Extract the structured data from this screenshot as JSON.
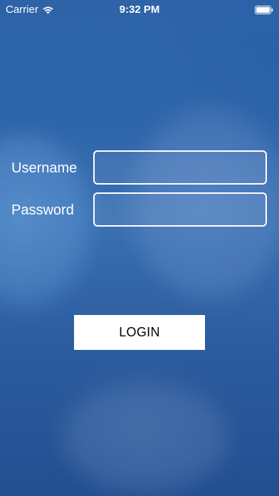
{
  "status_bar": {
    "carrier": "Carrier",
    "time": "9:32 PM",
    "wifi_icon": "wifi-icon",
    "battery_icon": "battery-icon"
  },
  "login_form": {
    "username_label": "Username",
    "username_value": "",
    "password_label": "Password",
    "password_value": "",
    "login_button_label": "LOGIN"
  },
  "colors": {
    "background": "#2f5f9e",
    "text": "#ffffff",
    "button_background": "#ffffff",
    "button_text": "#000000"
  }
}
